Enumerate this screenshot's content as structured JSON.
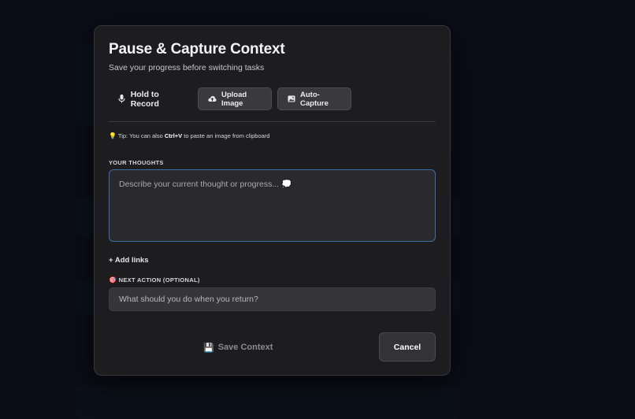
{
  "modal": {
    "title": "Pause & Capture Context",
    "subtitle": "Save your progress before switching tasks"
  },
  "capture_buttons": {
    "record_label": "Hold to Record",
    "upload_label": "Upload Image",
    "auto_label": "Auto-Capture"
  },
  "tip": {
    "prefix": "Tip: You can also ",
    "shortcut": "Ctrl+V",
    "suffix": " to paste an image from clipboard"
  },
  "thoughts": {
    "label": "YOUR THOUGHTS",
    "placeholder": "Describe your current thought or progress... 💭"
  },
  "links": {
    "add_label": "+ Add links"
  },
  "next_action": {
    "label": "NEXT ACTION (OPTIONAL)",
    "placeholder": "What should you do when you return?"
  },
  "footer": {
    "save_label": "Save Context",
    "cancel_label": "Cancel"
  },
  "colors": {
    "modal_bg": "#1e1e21",
    "focus_border": "#3d6ea8",
    "button_bg": "#3a3a3e"
  }
}
